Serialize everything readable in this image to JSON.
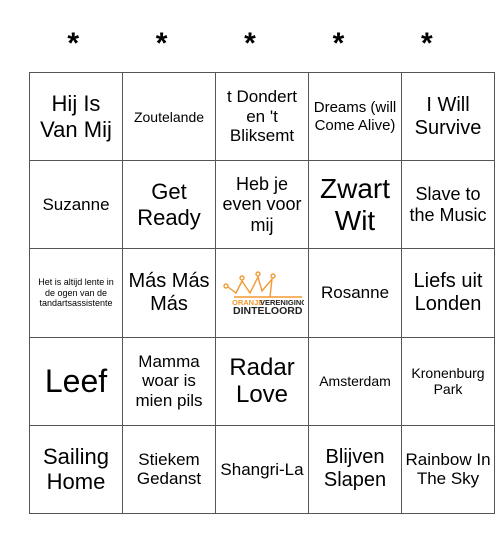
{
  "header": [
    "*",
    "*",
    "*",
    "*",
    "*"
  ],
  "cells": [
    [
      "Hij Is Van Mij",
      "Zoutelande",
      "t Dondert en 't Bliksemt",
      "Dreams (will Come Alive)",
      "I Will Survive"
    ],
    [
      "Suzanne",
      "Get Ready",
      "Heb je even voor mij",
      "Zwart Wit",
      "Slave to the Music"
    ],
    [
      "Het is altijd lente in de ogen van de tandartsassistente",
      "Más Más Más",
      "",
      "Rosanne",
      "Liefs uit Londen"
    ],
    [
      "Leef",
      "Mamma woar is mien pils",
      "Radar Love",
      "Amsterdam",
      "Kronenburg Park"
    ],
    [
      "Sailing Home",
      "Stiekem Gedanst",
      "Shangri-La",
      "Blijven Slapen",
      "Rainbow In The Sky"
    ]
  ],
  "free_space": {
    "logo_line1_a": "ORANJE",
    "logo_line1_b": "VERENIGING",
    "logo_line2": "DINTELOORD",
    "icon": "crown-icon"
  },
  "colors": {
    "brand_orange": "#f39a33",
    "grid_line": "#555555"
  }
}
